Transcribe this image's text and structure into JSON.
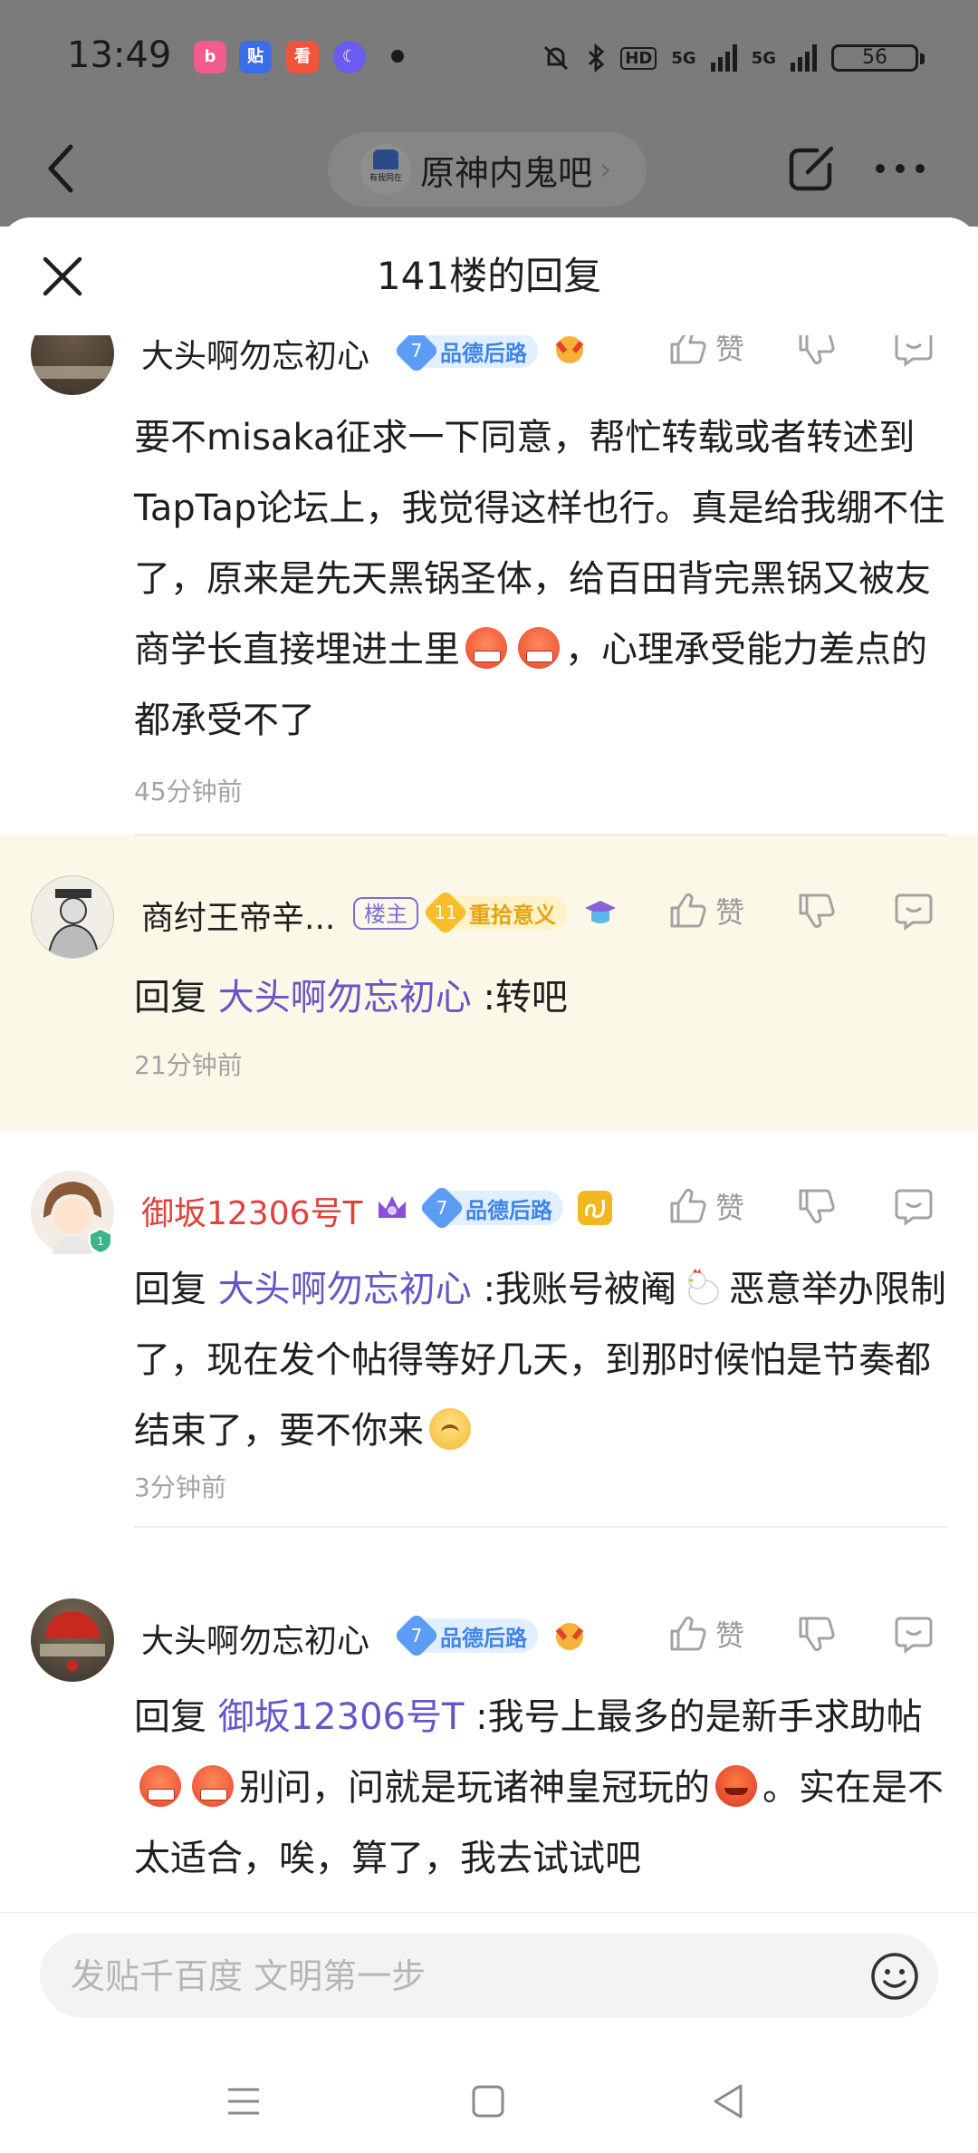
{
  "status_bar": {
    "time": "13:49",
    "app_icons": [
      {
        "name": "bilibili-icon",
        "color": "#f25d8e",
        "text": "b"
      },
      {
        "name": "tieba-icon",
        "color": "#3a6ee8",
        "text": "贴"
      },
      {
        "name": "video-app-icon",
        "color": "#f2533c",
        "text": "看"
      },
      {
        "name": "moon-app-icon",
        "color": "#6a5cf0",
        "text": "☾"
      }
    ],
    "hd_label": "HD",
    "network_1": "5G",
    "network_2": "5G",
    "battery": "56"
  },
  "top_nav": {
    "forum_name": "原神内鬼吧",
    "forum_logo_caption": "有我同在",
    "chevron": "›"
  },
  "sheet": {
    "title": "141楼的回复"
  },
  "replies": [
    {
      "username": "大头啊勿忘初心",
      "level": "7",
      "level_title": "品德后路",
      "like_label": "赞",
      "text": "要不misaka征求一下同意，帮忙转载或者转述到TapTap论坛上，我觉得这样也行。真是给我绷不住了，原来是先天黑锅圣体，给百田背完黑锅又被友商学长直接埋进土里",
      "text_after_emoji": "，心理承受能力差点的都承受不了",
      "time": "45分钟前"
    },
    {
      "username": "商纣王帝辛...",
      "host_badge": "楼主",
      "level": "11",
      "level_title": "重拾意义",
      "like_label": "赞",
      "reply_prefix": "回复",
      "mention": "大头啊勿忘初心",
      "text": ":转吧",
      "time": "21分钟前"
    },
    {
      "username": "御坂12306号T",
      "level": "7",
      "level_title": "品德后路",
      "like_label": "赞",
      "reply_prefix": "回复",
      "mention": "大头啊勿忘初心",
      "text_part1": ":我账号被阉",
      "text_part2": "恶意举办限制了，现在发个帖得等好几天，到那时候怕是节奏都结束了，要不你来",
      "time": "3分钟前"
    },
    {
      "username": "大头啊勿忘初心",
      "level": "7",
      "level_title": "品德后路",
      "like_label": "赞",
      "reply_prefix": "回复",
      "mention": "御坂12306号T",
      "text_part1": ":我号上最多的是新手求助帖",
      "text_part2": "别问，问就是玩诸神皇冠玩的",
      "text_part3": "。实在是不太适合，唉，算了，我去试试吧"
    }
  ],
  "input": {
    "placeholder": "发贴千百度 文明第一步"
  },
  "colors": {
    "accent": "#6656c8",
    "username_red": "#e0413c",
    "highlight_bg": "#fcf8e8",
    "dim_overlay": "#7b7b7b"
  }
}
